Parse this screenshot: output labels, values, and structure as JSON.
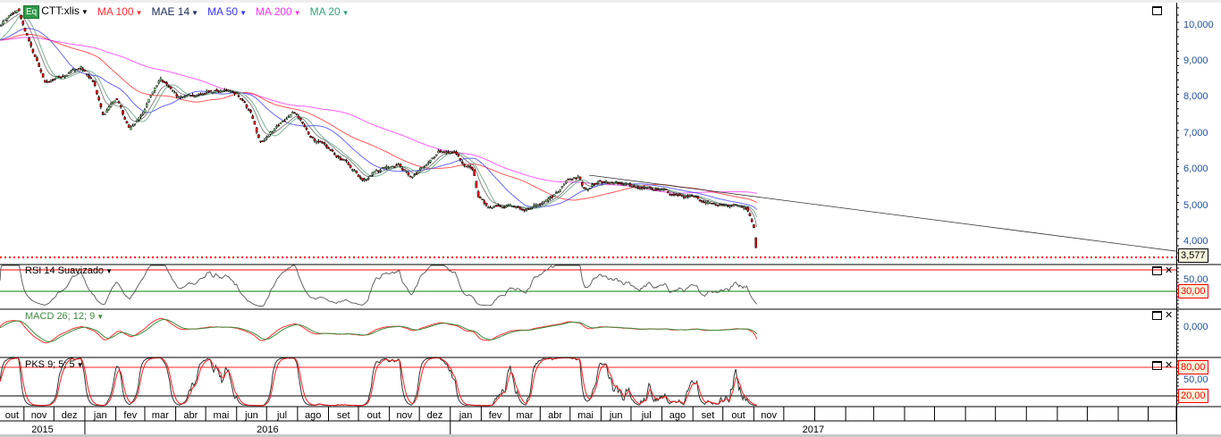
{
  "legend": {
    "symbol": "CTT:xlis",
    "badge": "Eq",
    "indicators": [
      {
        "label": "MA 100",
        "color": "#ff3030"
      },
      {
        "label": "MAE 14",
        "color": "#1a2a5a"
      },
      {
        "label": "MA 50",
        "color": "#3333ff"
      },
      {
        "label": "MA 200",
        "color": "#ff33ff"
      },
      {
        "label": "MA 20",
        "color": "#3aa07a"
      }
    ]
  },
  "panels": {
    "rsi": {
      "title": "RSI 14 Suavizado",
      "labels": [
        "50,00"
      ],
      "box": "30,00"
    },
    "macd": {
      "title": "MACD 26; 12; 9",
      "labels": [
        "0,000"
      ]
    },
    "pks": {
      "title": "PKS 9; 5; 5",
      "labels": [
        "50,00"
      ],
      "boxes": [
        "80,00",
        "20,00"
      ]
    }
  },
  "price_axis": {
    "labels": [
      "10,000",
      "9,000",
      "8,000",
      "7,000",
      "6,000",
      "5,000",
      "4,000"
    ],
    "last_price": "3,577"
  },
  "months": [
    "out",
    "nov",
    "dez",
    "jan",
    "fev",
    "mar",
    "abr",
    "mai",
    "jun",
    "jul",
    "ago",
    "set",
    "out",
    "nov",
    "dez",
    "jan",
    "fev",
    "mar",
    "abr",
    "mai",
    "jun",
    "jul",
    "ago",
    "set",
    "out",
    "nov"
  ],
  "years": [
    "2015",
    "2016",
    "2017"
  ],
  "icons": {
    "maximize": "window-maximize-icon",
    "close": "close-icon",
    "close_glyph": "✕"
  },
  "colors": {
    "up": "#8fe08f",
    "down": "#e60000",
    "rsi_upper": "#ff0000",
    "rsi_lower": "#008000",
    "macd": "#ff3030",
    "signal": "#3c8c3c",
    "pks_k": "#333333",
    "pks_d": "#ff2020",
    "last_price_line": "#ff0000"
  },
  "chart_data": {
    "type": "candlestick",
    "symbol": "CTT:xlis",
    "ylim": [
      3500,
      10500
    ],
    "y_ticks": [
      10000,
      9000,
      8000,
      7000,
      6000,
      5000,
      4000
    ],
    "last_price": 3577,
    "close": [
      [
        "2015-10-08",
        10000
      ],
      [
        "2015-10-26",
        10450
      ],
      [
        "2015-11-04",
        9700
      ],
      [
        "2015-11-13",
        9100
      ],
      [
        "2015-11-22",
        8400
      ],
      [
        "2015-12-05",
        8600
      ],
      [
        "2015-12-28",
        8850
      ],
      [
        "2016-01-10",
        8400
      ],
      [
        "2016-01-19",
        7500
      ],
      [
        "2016-02-01",
        8000
      ],
      [
        "2016-02-15",
        7100
      ],
      [
        "2016-02-28",
        7600
      ],
      [
        "2016-03-17",
        8600
      ],
      [
        "2016-04-04",
        8000
      ],
      [
        "2016-04-22",
        8100
      ],
      [
        "2016-05-14",
        8200
      ],
      [
        "2016-06-01",
        8100
      ],
      [
        "2016-06-15",
        7600
      ],
      [
        "2016-06-24",
        6750
      ],
      [
        "2016-07-12",
        7250
      ],
      [
        "2016-07-29",
        7600
      ],
      [
        "2016-08-12",
        7000
      ],
      [
        "2016-08-30",
        6600
      ],
      [
        "2016-09-17",
        6250
      ],
      [
        "2016-10-05",
        5750
      ],
      [
        "2016-10-18",
        6000
      ],
      [
        "2016-11-09",
        6200
      ],
      [
        "2016-11-23",
        5800
      ],
      [
        "2016-12-06",
        6100
      ],
      [
        "2016-12-20",
        6450
      ],
      [
        "2017-01-05",
        6550
      ],
      [
        "2017-01-16",
        6100
      ],
      [
        "2017-01-24",
        6000
      ],
      [
        "2017-01-29",
        5250
      ],
      [
        "2017-02-07",
        5000
      ],
      [
        "2017-02-25",
        5050
      ],
      [
        "2017-03-15",
        4900
      ],
      [
        "2017-03-28",
        5000
      ],
      [
        "2017-04-15",
        5250
      ],
      [
        "2017-04-28",
        5750
      ],
      [
        "2017-05-10",
        5800
      ],
      [
        "2017-05-16",
        5400
      ],
      [
        "2017-05-30",
        5650
      ],
      [
        "2017-06-17",
        5600
      ],
      [
        "2017-07-05",
        5550
      ],
      [
        "2017-07-27",
        5450
      ],
      [
        "2017-08-18",
        5300
      ],
      [
        "2017-09-10",
        5150
      ],
      [
        "2017-10-02",
        5050
      ],
      [
        "2017-10-25",
        5000
      ],
      [
        "2017-11-01",
        4400
      ],
      [
        "2017-11-04",
        3577
      ]
    ],
    "overlays": [
      "MA 100",
      "MAE 14",
      "MA 50",
      "MA 200",
      "MA 20"
    ],
    "trendline": [
      [
        "2017-05-20",
        5860
      ],
      [
        "2018-12-29",
        3750
      ]
    ],
    "rsi": {
      "period": 14,
      "levels": [
        70,
        30
      ]
    },
    "macd": {
      "slow": 26,
      "fast": 12,
      "signal": 9,
      "zero": 0
    },
    "pks": {
      "params": [
        9,
        5,
        5
      ],
      "levels": [
        80,
        20
      ]
    }
  }
}
